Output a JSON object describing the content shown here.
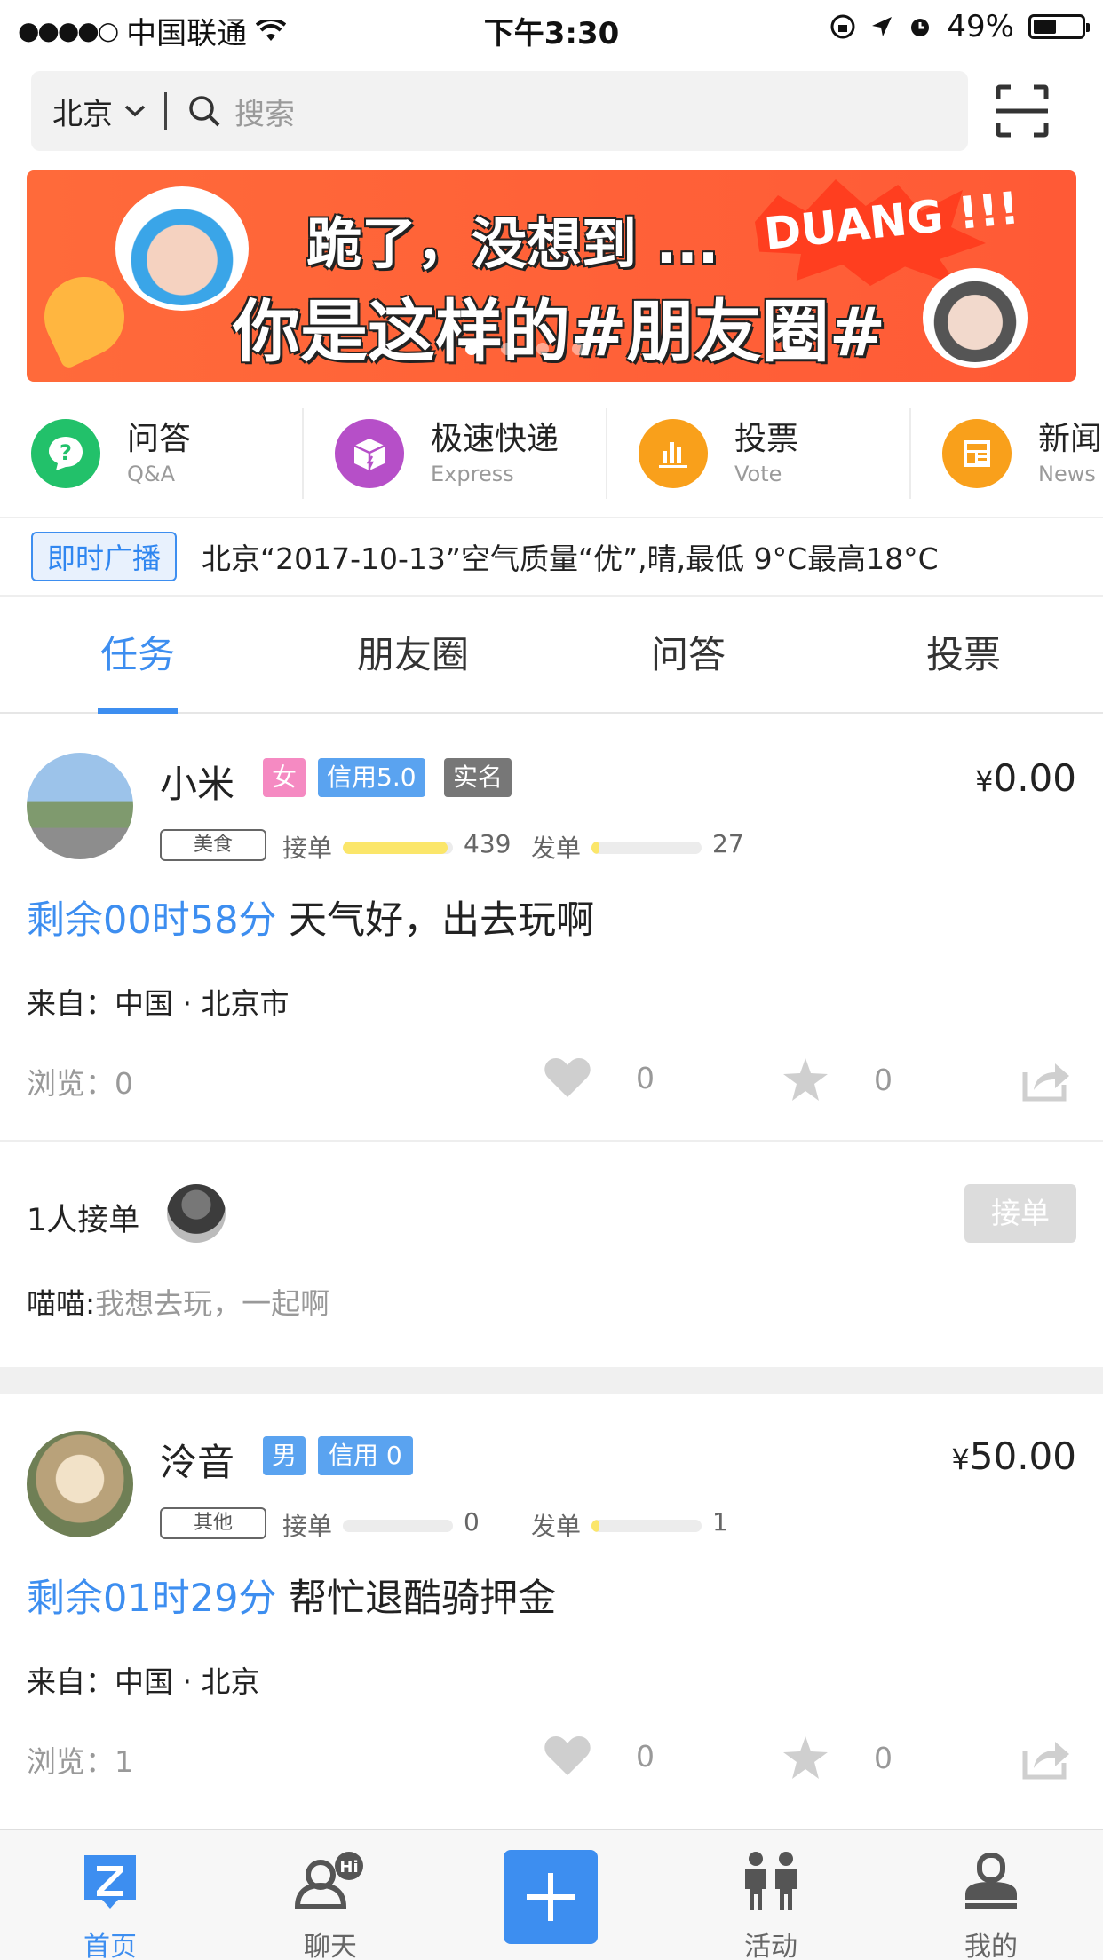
{
  "status_bar": {
    "carrier": "中国联通",
    "time": "下午3:30",
    "battery": "49%",
    "battery_level": 0.49
  },
  "search": {
    "city": "北京",
    "placeholder": "搜索"
  },
  "banner": {
    "line1": "跪了，没想到 ...",
    "line2": "你是这样的#朋友圈#",
    "burst_text": "DUANG !!!",
    "slides": 4,
    "active_slide": 0
  },
  "categories": [
    {
      "zh": "问答",
      "en": "Q&A",
      "icon": "question-icon",
      "color": "#22c16a"
    },
    {
      "zh": "极速快递",
      "en": "Express",
      "icon": "package-icon",
      "color": "#b64fc8"
    },
    {
      "zh": "投票",
      "en": "Vote",
      "icon": "vote-chart-icon",
      "color": "#f9a01b"
    },
    {
      "zh": "新闻",
      "en": "News",
      "icon": "news-icon",
      "color": "#f9a01b"
    }
  ],
  "broadcast": {
    "tag": "即时广播",
    "text": "北京“2017-10-13”空气质量“优”,晴,最低 9°C最高18°C"
  },
  "tabs": [
    "任务",
    "朋友圈",
    "问答",
    "投票"
  ],
  "active_tab": 0,
  "tasks": [
    {
      "name": "小米",
      "gender": "女",
      "gender_color": "#f58ac2",
      "credit": "信用5.0",
      "verified": "实名",
      "price_symbol": "¥",
      "price": "0.00",
      "category": "美食",
      "accept_label": "接单",
      "accept_count": "439",
      "accept_level": 0.95,
      "post_label": "发单",
      "post_count": "27",
      "post_level": 0.07,
      "remaining": "剩余00时58分",
      "title": "天气好，出去玩啊",
      "from_label": "来自：",
      "from": "中国 · 北京市",
      "views_label": "浏览：",
      "views": "0",
      "likes": "0",
      "favorites": "0",
      "accepted_text": "1人接单",
      "accept_button": "接单",
      "commenter": "喵喵:",
      "comment": "我想去玩，一起啊"
    },
    {
      "name": "泠音",
      "gender": "男",
      "gender_color": "#5aa3f0",
      "credit": "信用 0",
      "price_symbol": "¥",
      "price": "50.00",
      "category": "其他",
      "accept_label": "接单",
      "accept_count": "0",
      "accept_level": 0,
      "post_label": "发单",
      "post_count": "1",
      "post_level": 0.07,
      "remaining": "剩余01时29分",
      "title": "帮忙退酷骑押金",
      "from_label": "来自：",
      "from": "中国 · 北京",
      "views_label": "浏览：",
      "views": "1",
      "likes": "0",
      "favorites": "0"
    }
  ],
  "bottom_nav": [
    {
      "label": "首页",
      "icon": "home-z-icon",
      "active": true
    },
    {
      "label": "聊天",
      "icon": "chat-hi-icon",
      "active": false
    },
    {
      "label": "",
      "icon": "plus-icon",
      "active": false
    },
    {
      "label": "活动",
      "icon": "activity-people-icon",
      "active": false
    },
    {
      "label": "我的",
      "icon": "profile-icon",
      "active": false
    }
  ],
  "colors": {
    "accent": "#3d8ef0",
    "banner": "#ff5a36",
    "progress": "#fbe66a"
  }
}
